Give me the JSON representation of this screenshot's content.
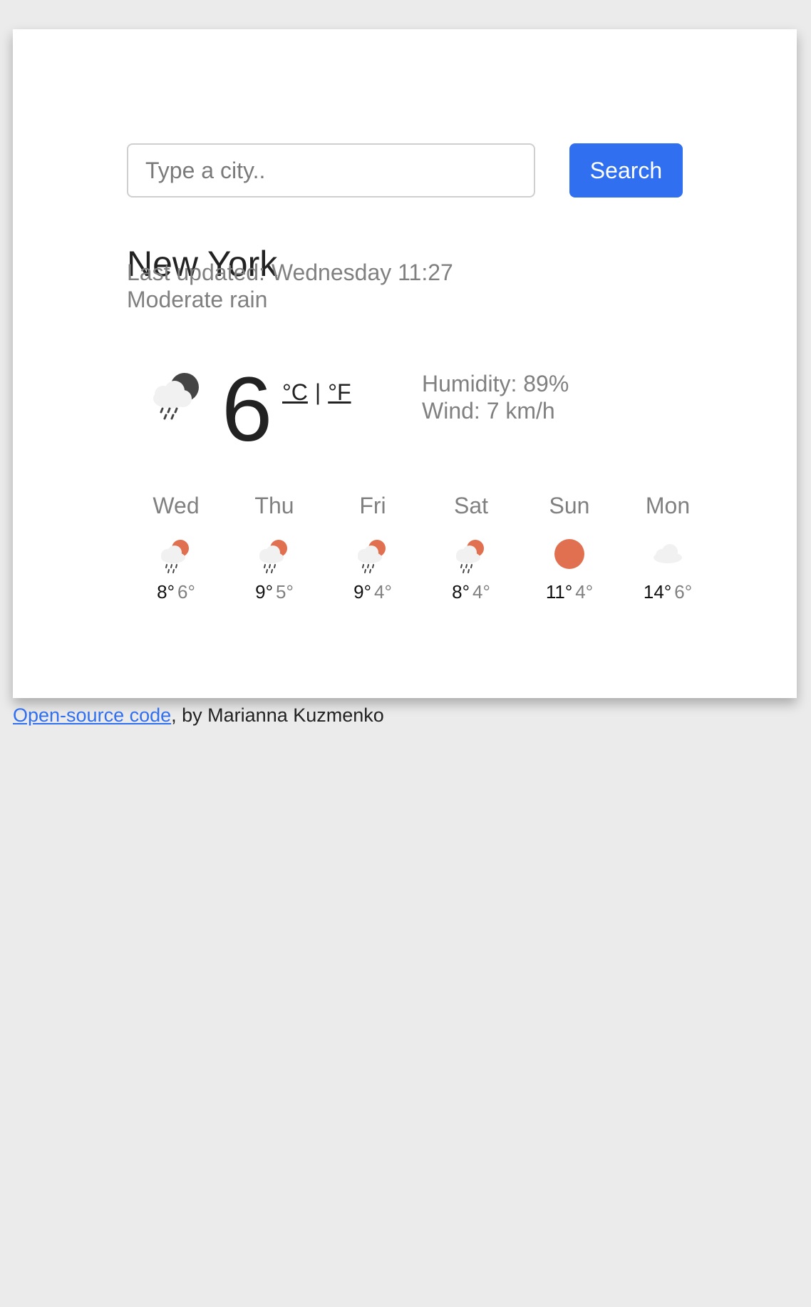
{
  "search": {
    "placeholder": "Type a city..",
    "button_label": "Search"
  },
  "current": {
    "city": "New York",
    "last_updated": "Last updated: Wednesday 11:27",
    "description": "Moderate rain",
    "temperature": "6",
    "icon": "rain-night-icon",
    "unit_celsius": "°C",
    "unit_separator": "|",
    "unit_fahrenheit": "°F",
    "humidity": "Humidity: 89%",
    "wind": "Wind: 7 km/h"
  },
  "forecast": [
    {
      "day": "Wed",
      "max": "8°",
      "min": "6°",
      "icon": "rain-sun-icon"
    },
    {
      "day": "Thu",
      "max": "9°",
      "min": "5°",
      "icon": "rain-sun-icon"
    },
    {
      "day": "Fri",
      "max": "9°",
      "min": "4°",
      "icon": "rain-sun-icon"
    },
    {
      "day": "Sat",
      "max": "8°",
      "min": "4°",
      "icon": "rain-sun-icon"
    },
    {
      "day": "Sun",
      "max": "11°",
      "min": "4°",
      "icon": "sun-icon"
    },
    {
      "day": "Mon",
      "max": "14°",
      "min": "6°",
      "icon": "cloud-icon"
    }
  ],
  "footer": {
    "link_text": "Open-source code",
    "author_text": ", by Marianna Kuzmenko"
  },
  "colors": {
    "accent": "#2f6ff0",
    "sun": "#e0704f",
    "background": "#ebebeb"
  }
}
